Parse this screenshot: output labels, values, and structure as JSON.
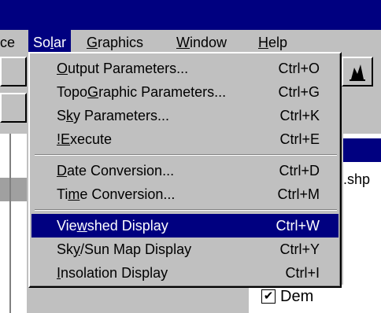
{
  "menubar": {
    "items": [
      {
        "label": "ce"
      },
      {
        "label": "Solar"
      },
      {
        "label": "Graphics"
      },
      {
        "label": "Window"
      },
      {
        "label": "Help"
      }
    ]
  },
  "solar_menu": {
    "groups": [
      [
        {
          "label": "Output Parameters...",
          "shortcut": "Ctrl+O"
        },
        {
          "label": "TopoGraphic Parameters...",
          "shortcut": "Ctrl+G"
        },
        {
          "label": "Sky Parameters...",
          "shortcut": "Ctrl+K"
        },
        {
          "label": "!Execute",
          "shortcut": "Ctrl+E"
        }
      ],
      [
        {
          "label": "Date Conversion...",
          "shortcut": "Ctrl+D"
        },
        {
          "label": "Time Conversion...",
          "shortcut": "Ctrl+M"
        }
      ],
      [
        {
          "label": "Viewshed Display",
          "shortcut": "Ctrl+W",
          "highlighted": true
        },
        {
          "label": "Sky/Sun Map Display",
          "shortcut": "Ctrl+Y"
        },
        {
          "label": "Insolation Display",
          "shortcut": "Ctrl+I"
        }
      ]
    ]
  },
  "right_panel": {
    "file_fragment": ".shp",
    "legend_item": "Dem",
    "legend_checked": true
  }
}
